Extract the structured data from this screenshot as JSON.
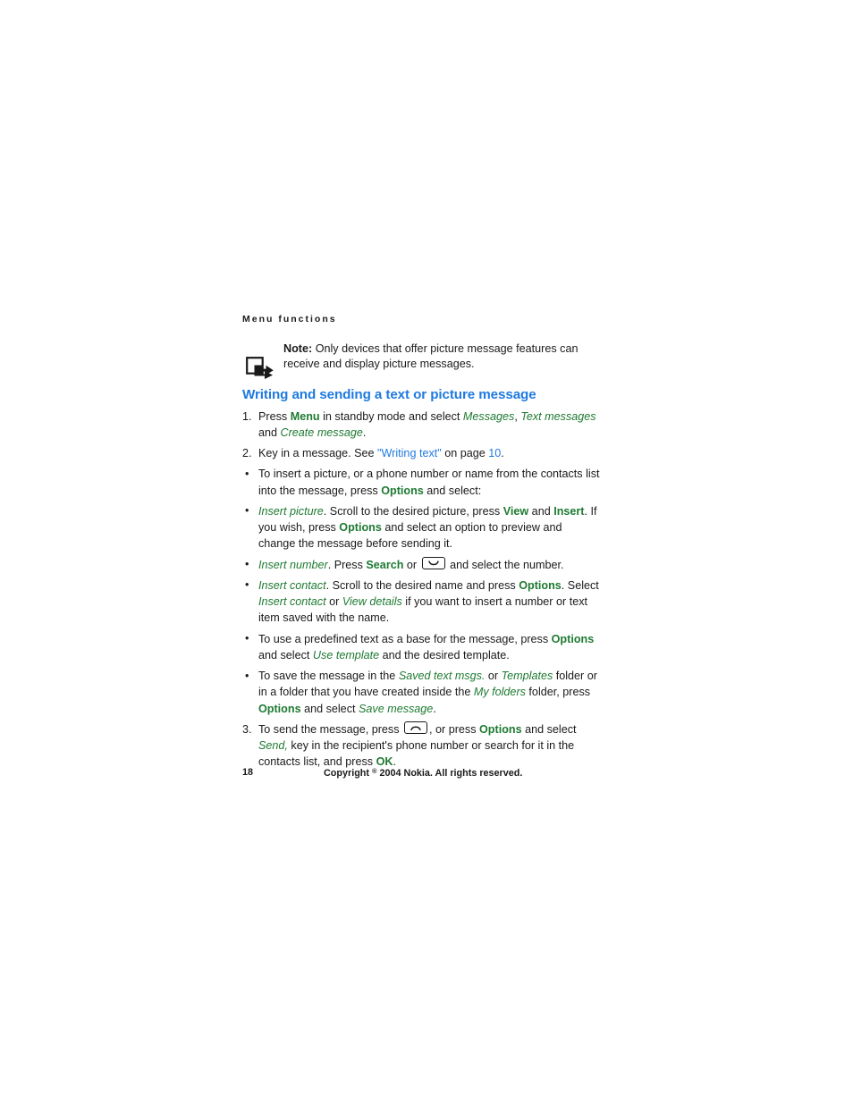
{
  "running_header": "Menu functions",
  "note": {
    "icon": "note-pointer-icon",
    "label": "Note:",
    "text": "Only devices that offer picture message features can receive and display picture messages."
  },
  "section": {
    "heading": "Writing and sending a text or picture message"
  },
  "steps": [
    {
      "marker": "1.",
      "runs": [
        {
          "t": "Press ",
          "s": "plain"
        },
        {
          "t": "Menu",
          "s": "b-green"
        },
        {
          "t": " in standby mode and select ",
          "s": "plain"
        },
        {
          "t": "Messages",
          "s": "i-green"
        },
        {
          "t": ", ",
          "s": "plain"
        },
        {
          "t": "Text messages",
          "s": "i-green"
        },
        {
          "t": " and ",
          "s": "plain"
        },
        {
          "t": "Create message",
          "s": "i-green"
        },
        {
          "t": ".",
          "s": "plain"
        }
      ]
    },
    {
      "marker": "2.",
      "runs": [
        {
          "t": "Key in a message. See ",
          "s": "plain"
        },
        {
          "t": "\"Writing text\"",
          "s": "link"
        },
        {
          "t": " on page ",
          "s": "plain"
        },
        {
          "t": "10",
          "s": "link"
        },
        {
          "t": ".",
          "s": "plain"
        }
      ]
    },
    {
      "marker": "3.",
      "runs": [
        {
          "t": "To send the message, press ",
          "s": "plain"
        },
        {
          "t": "",
          "s": "key-call"
        },
        {
          "t": ", or press ",
          "s": "plain"
        },
        {
          "t": "Options",
          "s": "b-green"
        },
        {
          "t": " and select ",
          "s": "plain"
        },
        {
          "t": "Send,",
          "s": "i-green"
        },
        {
          "t": " key in the recipient's phone number or search for it in the contacts list, and press ",
          "s": "plain"
        },
        {
          "t": "OK",
          "s": "b-green"
        },
        {
          "t": ".",
          "s": "plain"
        }
      ]
    }
  ],
  "bullets_a": [
    {
      "dot": "•",
      "runs": [
        {
          "t": "To insert a picture, or a phone number or name from the contacts list into the message, press ",
          "s": "plain"
        },
        {
          "t": "Options",
          "s": "b-green"
        },
        {
          "t": " and select:",
          "s": "plain"
        }
      ]
    }
  ],
  "sub_bullets": [
    {
      "dot": "•",
      "runs": [
        {
          "t": "Insert picture",
          "s": "i-green"
        },
        {
          "t": ". Scroll to the desired picture, press ",
          "s": "plain"
        },
        {
          "t": "View",
          "s": "b-green"
        },
        {
          "t": " and ",
          "s": "plain"
        },
        {
          "t": "Insert",
          "s": "b-green"
        },
        {
          "t": ". If you wish, press ",
          "s": "plain"
        },
        {
          "t": "Options",
          "s": "b-green"
        },
        {
          "t": " and select an option to preview and change the message before sending it.",
          "s": "plain"
        }
      ]
    },
    {
      "dot": "•",
      "runs": [
        {
          "t": "Insert number",
          "s": "i-green"
        },
        {
          "t": ". Press ",
          "s": "plain"
        },
        {
          "t": "Search",
          "s": "b-green"
        },
        {
          "t": " or ",
          "s": "plain"
        },
        {
          "t": "",
          "s": "key-scroll"
        },
        {
          "t": " and select the number.",
          "s": "plain"
        }
      ]
    },
    {
      "dot": "•",
      "runs": [
        {
          "t": "Insert contact",
          "s": "i-green"
        },
        {
          "t": ". Scroll to the desired name and press ",
          "s": "plain"
        },
        {
          "t": "Options",
          "s": "b-green"
        },
        {
          "t": ". Select ",
          "s": "plain"
        },
        {
          "t": "Insert contact",
          "s": "i-green"
        },
        {
          "t": " or ",
          "s": "plain"
        },
        {
          "t": "View details",
          "s": "i-green"
        },
        {
          "t": " if you want to insert a number or text item saved with the name.",
          "s": "plain"
        }
      ]
    }
  ],
  "bullets_b": [
    {
      "dot": "•",
      "runs": [
        {
          "t": "To use a predefined text as a base for the message, press ",
          "s": "plain"
        },
        {
          "t": "Options",
          "s": "b-green"
        },
        {
          "t": " and select ",
          "s": "plain"
        },
        {
          "t": "Use template",
          "s": "i-green"
        },
        {
          "t": " and the desired template.",
          "s": "plain"
        }
      ]
    },
    {
      "dot": "•",
      "runs": [
        {
          "t": "To save the message in the ",
          "s": "plain"
        },
        {
          "t": "Saved text msgs.",
          "s": "i-green"
        },
        {
          "t": " or ",
          "s": "plain"
        },
        {
          "t": "Templates",
          "s": "i-green"
        },
        {
          "t": " folder or in a folder that you have created inside the ",
          "s": "plain"
        },
        {
          "t": "My folders",
          "s": "i-green"
        },
        {
          "t": " folder, press ",
          "s": "plain"
        },
        {
          "t": "Options",
          "s": "b-green"
        },
        {
          "t": " and select ",
          "s": "plain"
        },
        {
          "t": "Save message",
          "s": "i-green"
        },
        {
          "t": ".",
          "s": "plain"
        }
      ]
    }
  ],
  "footer": {
    "page_number": "18",
    "copyright_prefix": "Copyright ",
    "copyright_symbol": "®",
    "copyright_suffix": " 2004 Nokia. All rights reserved."
  },
  "colors": {
    "heading_blue": "#1f7ae0",
    "ui_green": "#1e7a32",
    "body_text": "#1a1a1a"
  }
}
